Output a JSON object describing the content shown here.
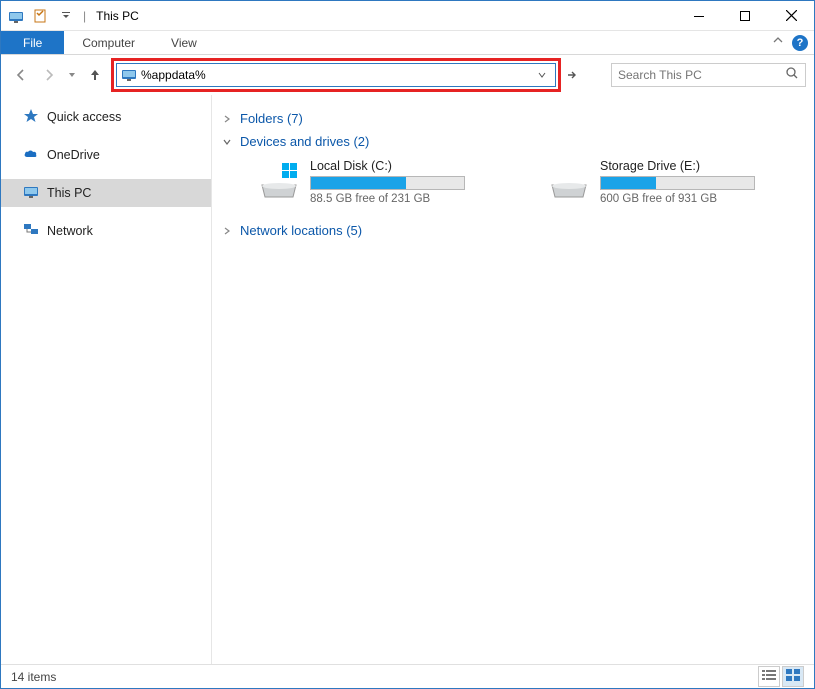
{
  "window": {
    "title": "This PC"
  },
  "ribbon": {
    "file": "File",
    "computer": "Computer",
    "view": "View"
  },
  "address": {
    "value": "%appdata%"
  },
  "search": {
    "placeholder": "Search This PC"
  },
  "sidebar": {
    "quick_access": "Quick access",
    "onedrive": "OneDrive",
    "this_pc": "This PC",
    "network": "Network"
  },
  "sections": {
    "folders": "Folders (7)",
    "devices": "Devices and drives (2)",
    "network_locations": "Network locations (5)"
  },
  "drives": [
    {
      "name": "Local Disk (C:)",
      "free": "88.5 GB free of 231 GB",
      "pct": 62
    },
    {
      "name": "Storage Drive (E:)",
      "free": "600 GB free of 931 GB",
      "pct": 36
    }
  ],
  "status": {
    "items": "14 items"
  }
}
